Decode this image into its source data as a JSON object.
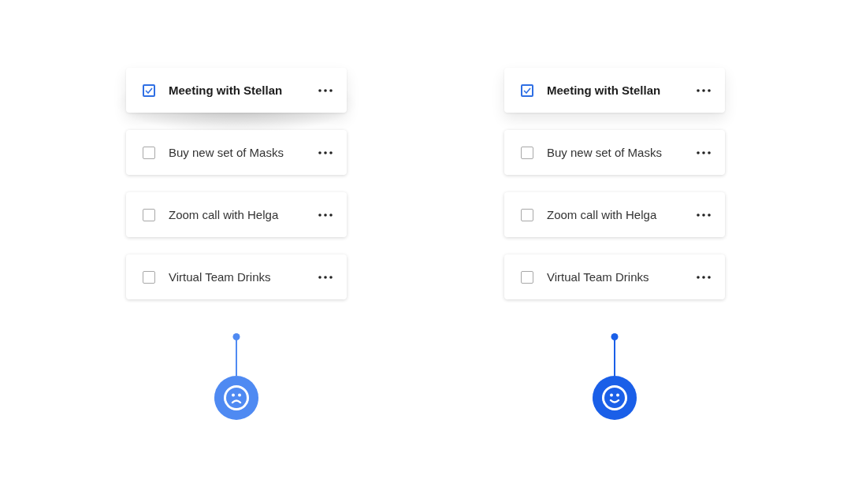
{
  "panels": [
    {
      "elevated": true,
      "kind": "sad",
      "tasks": [
        {
          "label": "Meeting with Stellan",
          "checked": true
        },
        {
          "label": "Buy new set of Masks",
          "checked": false
        },
        {
          "label": "Zoom call with Helga",
          "checked": false
        },
        {
          "label": "Virtual Team Drinks",
          "checked": false
        }
      ]
    },
    {
      "elevated": false,
      "kind": "happy",
      "tasks": [
        {
          "label": "Meeting with Stellan",
          "checked": true
        },
        {
          "label": "Buy new set of Masks",
          "checked": false
        },
        {
          "label": "Zoom call with Helga",
          "checked": false
        },
        {
          "label": "Virtual Team Drinks",
          "checked": false
        }
      ]
    }
  ]
}
